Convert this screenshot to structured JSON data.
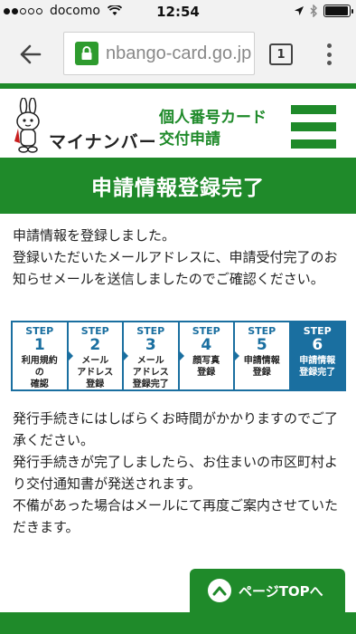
{
  "status_bar": {
    "carrier": "docomo",
    "time": "12:54",
    "signal_bars_on": 2,
    "battery_level": 0.95
  },
  "browser": {
    "url": "nbango-card.go.jp",
    "tab_count": "1"
  },
  "header": {
    "logo_text": "マイナンバー",
    "title_line1": "個人番号カード",
    "title_line2": "交付申請"
  },
  "banner": {
    "title": "申請情報登録完了"
  },
  "intro": {
    "line1": "申請情報を登録しました。",
    "line2": "登録いただいたメールアドレスに、申請受付完了のお知らせメールを送信しましたのでご確認ください。"
  },
  "steps": [
    {
      "label": "STEP",
      "num": "1",
      "desc": "利用規約\nの\n確認"
    },
    {
      "label": "STEP",
      "num": "2",
      "desc": "メール\nアドレス\n登録"
    },
    {
      "label": "STEP",
      "num": "3",
      "desc": "メール\nアドレス\n登録完了"
    },
    {
      "label": "STEP",
      "num": "4",
      "desc": "顔写真\n登録"
    },
    {
      "label": "STEP",
      "num": "5",
      "desc": "申請情報\n登録"
    },
    {
      "label": "STEP",
      "num": "6",
      "desc": "申請情報\n登録完了"
    }
  ],
  "active_step": 6,
  "notes": {
    "p1": "発行手続きにはしばらくお時間がかかりますのでご了承ください。",
    "p2": "発行手続きが完了しましたら、お住まいの市区町村より交付通知書が発送されます。",
    "p3": "不備があった場合はメールにて再度ご案内させていただきます。"
  },
  "pagetop": {
    "label": "ページTOPへ"
  },
  "colors": {
    "brand_green": "#1f8a2a",
    "step_blue": "#1a6fa0"
  }
}
